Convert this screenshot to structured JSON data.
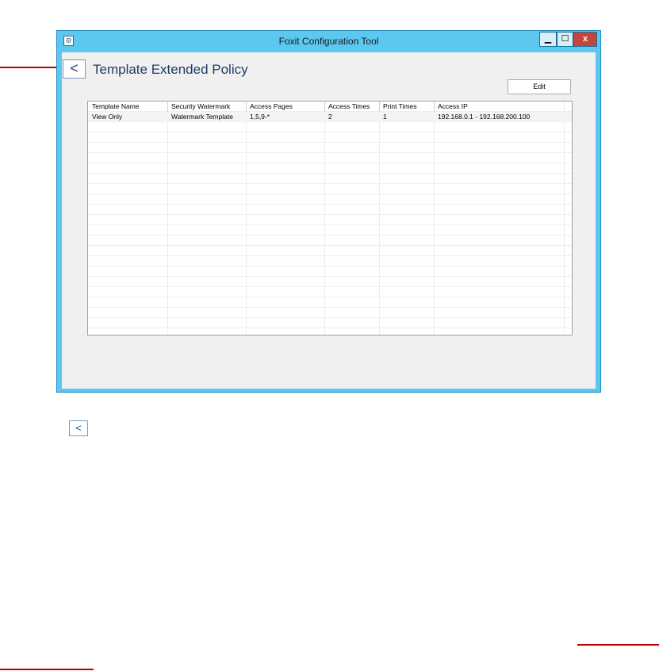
{
  "window": {
    "title": "Foxit Configuration Tool",
    "minimize_glyph": "▁",
    "maximize_glyph": "☐",
    "close_glyph": "x"
  },
  "page": {
    "back_glyph": "<",
    "title": "Template Extended Policy",
    "edit_label": "Edit"
  },
  "table": {
    "columns": [
      "Template Name",
      "Security Watermark",
      "Access Pages",
      "Access Times",
      "Print Times",
      "Access IP"
    ],
    "rows": [
      [
        "View Only",
        "Watermark Template",
        "1,5,9-*",
        "2",
        "1",
        "192.168.0.1 - 192.168.200.100"
      ]
    ]
  },
  "outside_back_glyph": "<",
  "colors": {
    "titlebar": "#5cc8f0",
    "close_button": "#c7463b",
    "title_text": "#1f3a68",
    "red_rule": "#c00000"
  }
}
